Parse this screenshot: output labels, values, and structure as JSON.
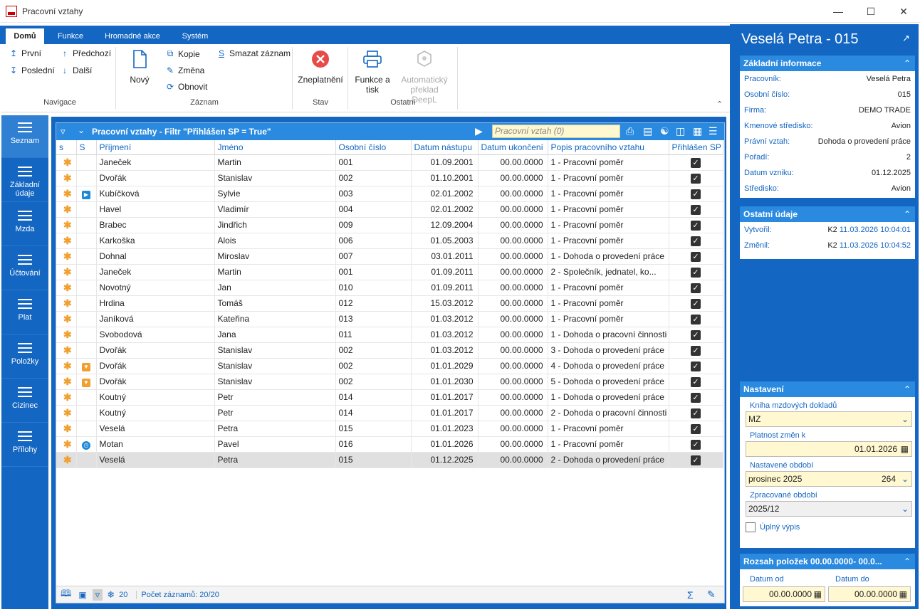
{
  "window": {
    "title": "Pracovní vztahy"
  },
  "ribbon": {
    "tabs": [
      "Domů",
      "Funkce",
      "Hromadné akce",
      "Systém"
    ],
    "nav": {
      "first": "První",
      "prev": "Předchozí",
      "last": "Poslední",
      "next": "Další",
      "group": "Navigace"
    },
    "record": {
      "new": "Nový",
      "copy": "Kopie",
      "change": "Změna",
      "refresh": "Obnovit",
      "delete": "Smazat záznam",
      "group": "Záznam"
    },
    "state": {
      "invalidate": "Zneplatnění",
      "group": "Stav"
    },
    "other": {
      "print": "Funkce a tisk",
      "deepl": "Automatický překlad DeepL",
      "group": "Ostatní"
    }
  },
  "leftnav": [
    "Seznam",
    "Základní údaje",
    "Mzda",
    "Účtování",
    "Plat",
    "Položky",
    "Cizinec",
    "Přílohy"
  ],
  "grid": {
    "title": "Pracovní vztahy - Filtr \"Přihlášen SP = True\"",
    "search_placeholder": "Pracovní vztah (0)",
    "columns": [
      "s",
      "S",
      "Příjmení",
      "Jméno",
      "Osobní číslo",
      "Datum nástupu",
      "Datum ukončení",
      "Popis pracovního vztahu",
      "Přihlášen SP"
    ],
    "rows": [
      {
        "icon": "",
        "surname": "Janeček",
        "name": "Martin",
        "num": "001",
        "start": "01.09.2001",
        "end": "00.00.0000",
        "desc": "1 - Pracovní poměr"
      },
      {
        "icon": "",
        "surname": "Dvořák",
        "name": "Stanislav",
        "num": "002",
        "start": "01.10.2001",
        "end": "00.00.0000",
        "desc": "1 - Pracovní poměr"
      },
      {
        "icon": "play",
        "surname": "Kubíčková",
        "name": "Sylvie",
        "num": "003",
        "start": "02.01.2002",
        "end": "00.00.0000",
        "desc": "1 - Pracovní poměr"
      },
      {
        "icon": "",
        "surname": "Havel",
        "name": "Vladimír",
        "num": "004",
        "start": "02.01.2002",
        "end": "00.00.0000",
        "desc": "1 - Pracovní poměr"
      },
      {
        "icon": "",
        "surname": "Brabec",
        "name": "Jindřich",
        "num": "009",
        "start": "12.09.2004",
        "end": "00.00.0000",
        "desc": "1 - Pracovní poměr"
      },
      {
        "icon": "",
        "surname": "Karkoška",
        "name": "Alois",
        "num": "006",
        "start": "01.05.2003",
        "end": "00.00.0000",
        "desc": "1 - Pracovní poměr"
      },
      {
        "icon": "",
        "surname": "Dohnal",
        "name": "Miroslav",
        "num": "007",
        "start": "03.01.2011",
        "end": "00.00.0000",
        "desc": "1 - Dohoda o provedení práce"
      },
      {
        "icon": "",
        "surname": "Janeček",
        "name": "Martin",
        "num": "001",
        "start": "01.09.2011",
        "end": "00.00.0000",
        "desc": "2 - Společník, jednatel, ko..."
      },
      {
        "icon": "",
        "surname": "Novotný",
        "name": "Jan",
        "num": "010",
        "start": "01.09.2011",
        "end": "00.00.0000",
        "desc": "1 - Pracovní poměr"
      },
      {
        "icon": "",
        "surname": "Hrdina",
        "name": "Tomáš",
        "num": "012",
        "start": "15.03.2012",
        "end": "00.00.0000",
        "desc": "1 - Pracovní poměr"
      },
      {
        "icon": "",
        "surname": "Janíková",
        "name": "Kateřina",
        "num": "013",
        "start": "01.03.2012",
        "end": "00.00.0000",
        "desc": "1 - Pracovní poměr"
      },
      {
        "icon": "",
        "surname": "Svobodová",
        "name": "Jana",
        "num": "011",
        "start": "01.03.2012",
        "end": "00.00.0000",
        "desc": "1 - Dohoda o pracovní činnosti"
      },
      {
        "icon": "",
        "surname": "Dvořák",
        "name": "Stanislav",
        "num": "002",
        "start": "01.03.2012",
        "end": "00.00.0000",
        "desc": "3 - Dohoda o provedení práce"
      },
      {
        "icon": "down",
        "surname": "Dvořák",
        "name": "Stanislav",
        "num": "002",
        "start": "01.01.2029",
        "end": "00.00.0000",
        "desc": "4 - Dohoda o provedení práce"
      },
      {
        "icon": "down",
        "surname": "Dvořák",
        "name": "Stanislav",
        "num": "002",
        "start": "01.01.2030",
        "end": "00.00.0000",
        "desc": "5 - Dohoda o provedení práce"
      },
      {
        "icon": "",
        "surname": "Koutný",
        "name": "Petr",
        "num": "014",
        "start": "01.01.2017",
        "end": "00.00.0000",
        "desc": "1 - Dohoda o provedení práce"
      },
      {
        "icon": "",
        "surname": "Koutný",
        "name": "Petr",
        "num": "014",
        "start": "01.01.2017",
        "end": "00.00.0000",
        "desc": "2 - Dohoda o pracovní činnosti"
      },
      {
        "icon": "",
        "surname": "Veselá",
        "name": "Petra",
        "num": "015",
        "start": "01.01.2023",
        "end": "00.00.0000",
        "desc": "1 - Pracovní poměr"
      },
      {
        "icon": "clock",
        "surname": "Motan",
        "name": "Pavel",
        "num": "016",
        "start": "01.01.2026",
        "end": "00.00.0000",
        "desc": "1 - Pracovní poměr"
      },
      {
        "icon": "",
        "surname": "Veselá",
        "name": "Petra",
        "num": "015",
        "start": "01.12.2025",
        "end": "00.00.0000",
        "desc": "2 - Dohoda o provedení práce"
      }
    ],
    "footer": {
      "count_value": "20",
      "records": "Počet záznamů: 20/20"
    }
  },
  "right": {
    "title": "Veselá Petra - 015",
    "basic": {
      "header": "Základní informace",
      "items": [
        {
          "k": "Pracovník:",
          "v": "Veselá Petra"
        },
        {
          "k": "Osobní číslo:",
          "v": "015"
        },
        {
          "k": "Firma:",
          "v": "DEMO TRADE"
        },
        {
          "k": "Kmenové středisko:",
          "v": "Avion"
        },
        {
          "k": "Právní vztah:",
          "v": "Dohoda o provedení práce"
        },
        {
          "k": "Pořadí:",
          "v": "2"
        },
        {
          "k": "Datum vzniku:",
          "v": "01.12.2025"
        },
        {
          "k": "Středisko:",
          "v": "Avion"
        }
      ]
    },
    "other": {
      "header": "Ostatní údaje",
      "created_label": "Vytvořil:",
      "created_user": "K2",
      "created_date": "11.03.2026 10:04:01",
      "changed_label": "Změnil:",
      "changed_user": "K2",
      "changed_date": "11.03.2026 10:04:52"
    },
    "settings": {
      "header": "Nastavení",
      "book_label": "Kniha mzdových dokladů",
      "book_value": "MZ",
      "validity_label": "Platnost změn k",
      "validity_value": "01.01.2026",
      "period_label": "Nastavené období",
      "period_value": "prosinec 2025",
      "period_num": "264",
      "processed_label": "Zpracované období",
      "processed_value": "2025/12",
      "full_label": "Úplný výpis"
    },
    "range": {
      "header": "Rozsah položek 00.00.0000- 00.0...",
      "from_label": "Datum od",
      "from_value": "00.00.0000",
      "to_label": "Datum do",
      "to_value": "00.00.0000"
    }
  }
}
